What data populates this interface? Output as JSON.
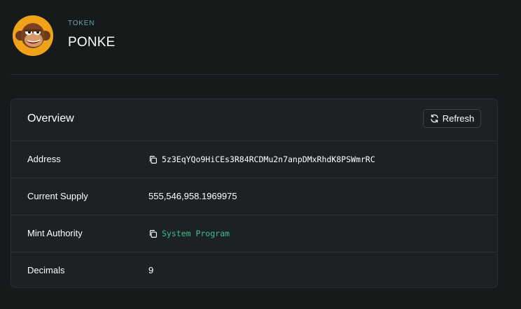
{
  "header": {
    "label": "TOKEN",
    "title": "PONKE",
    "avatar_icon": "ponke-monkey-avatar"
  },
  "overview": {
    "title": "Overview",
    "refresh_label": "Refresh",
    "refresh_icon": "refresh-icon",
    "rows": [
      {
        "label": "Address",
        "value": "5z3EqYQo9HiCEs3R84RCDMu2n7anpDMxRhdK8PSWmrRC",
        "copy_icon": "copy-icon"
      },
      {
        "label": "Current Supply",
        "value": "555,546,958.1969975"
      },
      {
        "label": "Mint Authority",
        "value": "System Program",
        "copy_icon": "copy-icon"
      },
      {
        "label": "Decimals",
        "value": "9"
      }
    ]
  },
  "colors": {
    "background": "#161a1b",
    "card": "#1c2123",
    "accent_green": "#3fbf8f",
    "label_green": "#6fa89a",
    "avatar_orange": "#f0a21a"
  }
}
